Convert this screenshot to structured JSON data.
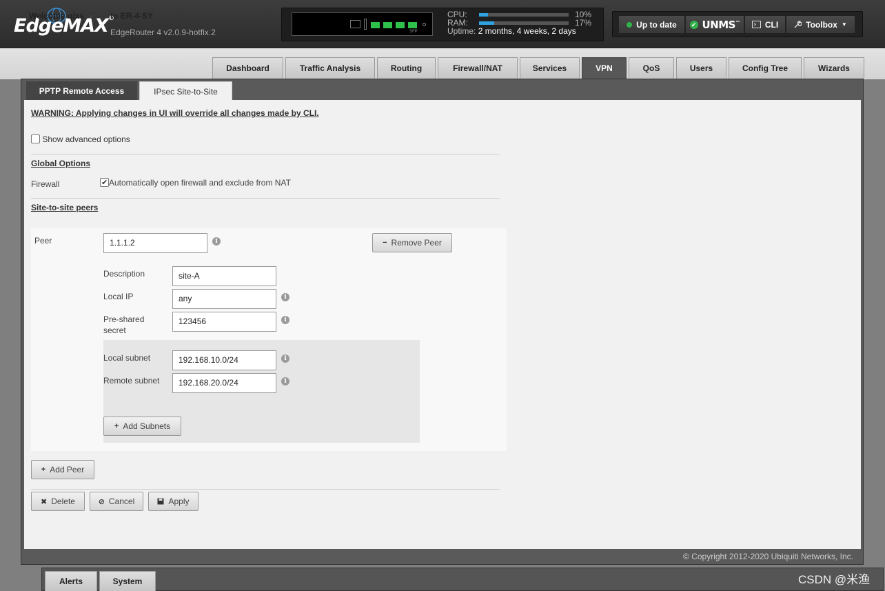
{
  "header": {
    "brand": "EdgeMAX",
    "brand_mark": "®",
    "model": "EdgeRouter 4 v2.0.9-hotfix.2",
    "sfp_label": "SFP",
    "cpu_label": "CPU:",
    "cpu_value": "10%",
    "cpu_percent": 10,
    "ram_label": "RAM:",
    "ram_value": "17%",
    "ram_percent": 17,
    "uptime_label": "Uptime:",
    "uptime_value": "2 months, 4 weeks, 2 days",
    "update_status": "Up to date",
    "unms_label": "UNMS",
    "unms_mark": "™",
    "cli_label": "CLI",
    "toolbox_label": "Toolbox",
    "status_color": "#32b34a",
    "accent_color": "#2ea3e0"
  },
  "user": {
    "welcome": "Welcome qixs",
    "host": "to ER-4-SY"
  },
  "nav": {
    "tabs": [
      "Dashboard",
      "Traffic Analysis",
      "Routing",
      "Firewall/NAT",
      "Services",
      "VPN",
      "QoS",
      "Users",
      "Config Tree",
      "Wizards"
    ],
    "active": "VPN"
  },
  "vpn": {
    "subtabs": [
      "PPTP Remote Access",
      "IPsec Site-to-Site"
    ],
    "active_subtab": "IPsec Site-to-Site",
    "warning": "WARNING: Applying changes in UI will override all changes made by CLI.",
    "show_advanced_label": "Show advanced options",
    "show_advanced_checked": false,
    "global_options_title": "Global Options",
    "firewall_label": "Firewall",
    "firewall_option_label": "Automatically open firewall and exclude from NAT",
    "firewall_option_checked": true,
    "peers_title": "Site-to-site peers",
    "peer": {
      "peer_label": "Peer",
      "peer_value": "1.1.1.2",
      "remove_label": "Remove Peer",
      "description_label": "Description",
      "description_value": "site-A",
      "local_ip_label": "Local IP",
      "local_ip_value": "any",
      "psk_label_line1": "Pre-shared",
      "psk_label_line2": "secret",
      "psk_value": "123456",
      "local_subnet_label": "Local subnet",
      "local_subnet_value": "192.168.10.0/24",
      "remote_subnet_label": "Remote subnet",
      "remote_subnet_value": "192.168.20.0/24",
      "add_subnets_label": "Add Subnets"
    },
    "add_peer_label": "Add Peer",
    "delete_label": "Delete",
    "cancel_label": "Cancel",
    "apply_label": "Apply"
  },
  "footer": {
    "copyright": "© Copyright 2012-2020 Ubiquiti Networks, Inc.",
    "bottom_tabs": [
      "Alerts",
      "System"
    ],
    "watermark": "CSDN @米渔"
  }
}
